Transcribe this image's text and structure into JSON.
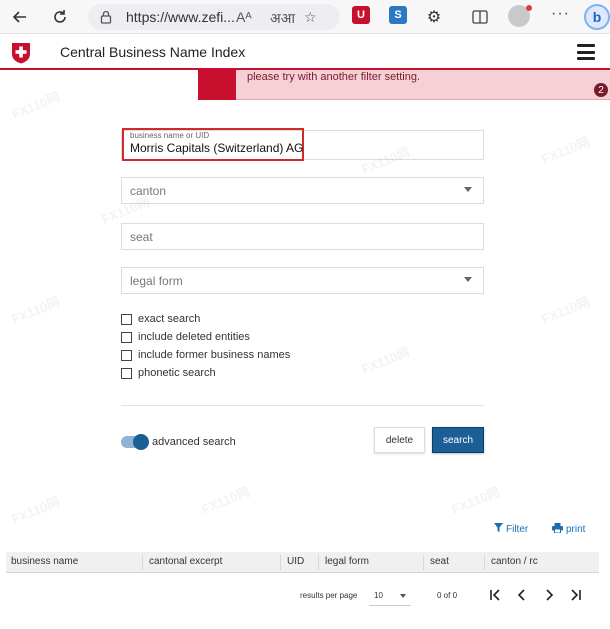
{
  "browser": {
    "url": "https://www.zefi...",
    "read_aloud_label": "Aᴬ",
    "translate_label": "अआ",
    "bing_label": "b"
  },
  "app": {
    "title": "Central Business Name Index"
  },
  "alert": {
    "text": "please try with another filter setting.",
    "badge": "2"
  },
  "form": {
    "name_label": "business name or UID",
    "name_value": "Morris Capitals (Switzerland) AG",
    "canton_placeholder": "canton",
    "seat_placeholder": "seat",
    "legal_form_placeholder": "legal form",
    "checkboxes": [
      {
        "label": "exact search"
      },
      {
        "label": "include deleted entities"
      },
      {
        "label": "include former business names"
      },
      {
        "label": "phonetic search"
      }
    ],
    "advanced_search_label": "advanced search",
    "delete_label": "delete",
    "search_label": "search"
  },
  "results": {
    "filter_label": "Filter",
    "print_label": "print",
    "columns": [
      "business name",
      "cantonal excerpt",
      "UID",
      "legal form",
      "seat",
      "canton / rc"
    ],
    "per_page_label": "results per page",
    "per_page_value": "10",
    "count_label": "0 of 0"
  },
  "watermark": {
    "text": "FX110网"
  },
  "colors": {
    "swiss_red": "#c8102e",
    "primary_blue": "#1c5f96",
    "link_blue": "#1c6fb5",
    "alert_bg": "#f5d0d6"
  }
}
